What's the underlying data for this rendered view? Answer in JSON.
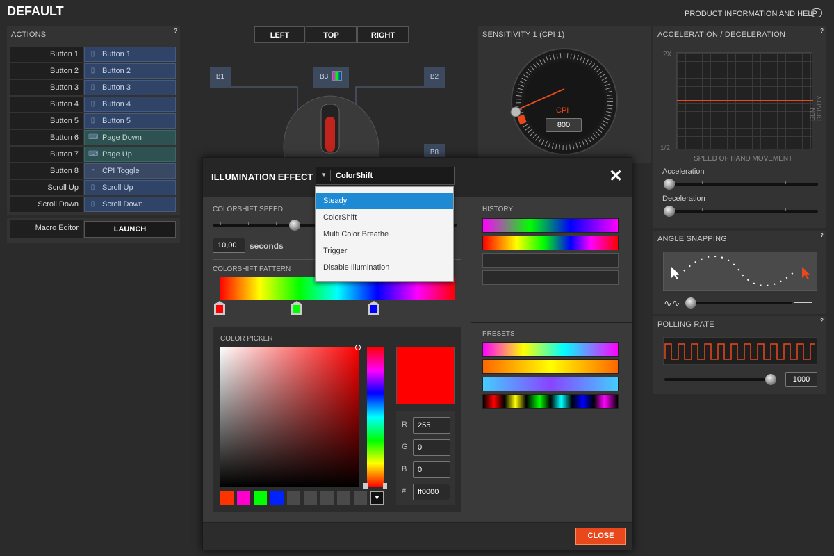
{
  "header": {
    "title": "DEFAULT",
    "product_info": "PRODUCT INFORMATION AND HELP"
  },
  "actions": {
    "title": "ACTIONS",
    "help": "?",
    "rows": [
      {
        "label": "Button 1",
        "value": "Button 1",
        "kind": "btn"
      },
      {
        "label": "Button 2",
        "value": "Button 2",
        "kind": "btn"
      },
      {
        "label": "Button 3",
        "value": "Button 3",
        "kind": "btn"
      },
      {
        "label": "Button 4",
        "value": "Button 4",
        "kind": "btn"
      },
      {
        "label": "Button 5",
        "value": "Button 5",
        "kind": "btn"
      },
      {
        "label": "Button 6",
        "value": "Page Down",
        "kind": "kbd"
      },
      {
        "label": "Button 7",
        "value": "Page Up",
        "kind": "kbd"
      },
      {
        "label": "Button 8",
        "value": "CPI Toggle",
        "kind": "cpi"
      },
      {
        "label": "Scroll Up",
        "value": "Scroll Up",
        "kind": "btn"
      },
      {
        "label": "Scroll Down",
        "value": "Scroll Down",
        "kind": "btn"
      }
    ],
    "macro_label": "Macro Editor",
    "launch": "LAUNCH"
  },
  "view_tabs": [
    "LEFT",
    "TOP",
    "RIGHT"
  ],
  "mouse_tags": {
    "b1": "B1",
    "b2": "B2",
    "b3": "B3",
    "b8": "B8"
  },
  "sensitivity": {
    "title": "SENSITIVITY 1 (CPI 1)",
    "gauge_label": "CPI",
    "value": "800",
    "help": "?"
  },
  "acceleration": {
    "title": "ACCELERATION / DECELERATION",
    "help": "?",
    "y_top": "2x",
    "y_bottom": "1/2",
    "x_label": "SPEED OF HAND MOVEMENT",
    "y_label": "SEN SITIVITY",
    "acceleration_label": "Acceleration",
    "deceleration_label": "Deceleration"
  },
  "angle_snapping": {
    "title": "ANGLE SNAPPING",
    "help": "?"
  },
  "polling": {
    "title": "POLLING RATE",
    "help": "?",
    "value": "1000"
  },
  "illumination": {
    "title": "ILLUMINATION EFFECT",
    "selected": "ColorShift",
    "options": [
      "Steady",
      "ColorShift",
      "Multi Color Breathe",
      "Trigger",
      "Disable Illumination"
    ],
    "speed_label": "COLORSHIFT SPEED",
    "speed_value": "10,00",
    "seconds": "seconds",
    "pattern_label": "COLORSHIFT PATTERN",
    "picker_label": "COLOR PICKER",
    "r_label": "R",
    "r": "255",
    "g_label": "G",
    "g": "0",
    "b_label": "B",
    "b": "0",
    "hex_label": "#",
    "hex": "ff0000",
    "history_label": "HISTORY",
    "presets_label": "PRESETS",
    "close": "CLOSE",
    "swatches": [
      "#ff3300",
      "#ff00cc",
      "#00ff00",
      "#0022ff"
    ]
  },
  "colors": {
    "accent": "#e8481c",
    "selection": "#1e8ad4",
    "panel": "#333333"
  }
}
